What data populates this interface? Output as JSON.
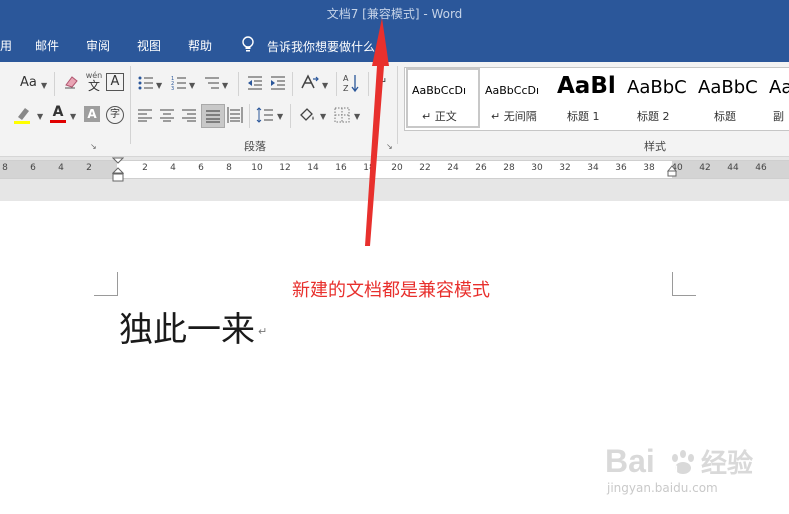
{
  "titlebar": {
    "title": "文档7 [兼容模式] - Word"
  },
  "menu": {
    "items": [
      "用",
      "邮件",
      "审阅",
      "视图",
      "帮助"
    ],
    "tell_me": "告诉我你想要做什么"
  },
  "ribbon": {
    "font_group": {
      "case_label": "Aa",
      "phonetic_label": "wén",
      "phonetic_char": "文",
      "border_char": "A",
      "shading_char": "A",
      "enclosed_char": "字"
    },
    "paragraph_label": "段落",
    "styles_label": "样式",
    "styles": [
      {
        "preview": "AaBbCcDı",
        "name": "↵ 正文"
      },
      {
        "preview": "AaBbCcDı",
        "name": "↵ 无间隔"
      },
      {
        "preview": "AaBl",
        "name": "标题 1"
      },
      {
        "preview": "AaBbC",
        "name": "标题 2"
      },
      {
        "preview": "AaBbC",
        "name": "标题"
      },
      {
        "preview": "Aa",
        "name": "副"
      }
    ]
  },
  "ruler": {
    "ticks": [
      "8",
      "6",
      "4",
      "2",
      "2",
      "4",
      "6",
      "8",
      "10",
      "12",
      "14",
      "16",
      "18",
      "20",
      "22",
      "24",
      "26",
      "28",
      "30",
      "32",
      "34",
      "36",
      "38",
      "40",
      "42",
      "44",
      "46"
    ]
  },
  "document": {
    "text": "独此一来",
    "para_mark": "↵"
  },
  "annotation": {
    "text": "新建的文档都是兼容模式",
    "color": "#e8302d"
  },
  "watermark": {
    "brand": "Bai du 经验",
    "url": "jingyan.baidu.com"
  },
  "colors": {
    "titlebar": "#2b579a",
    "highlight": "#ffff00",
    "font_color": "#e00000"
  }
}
